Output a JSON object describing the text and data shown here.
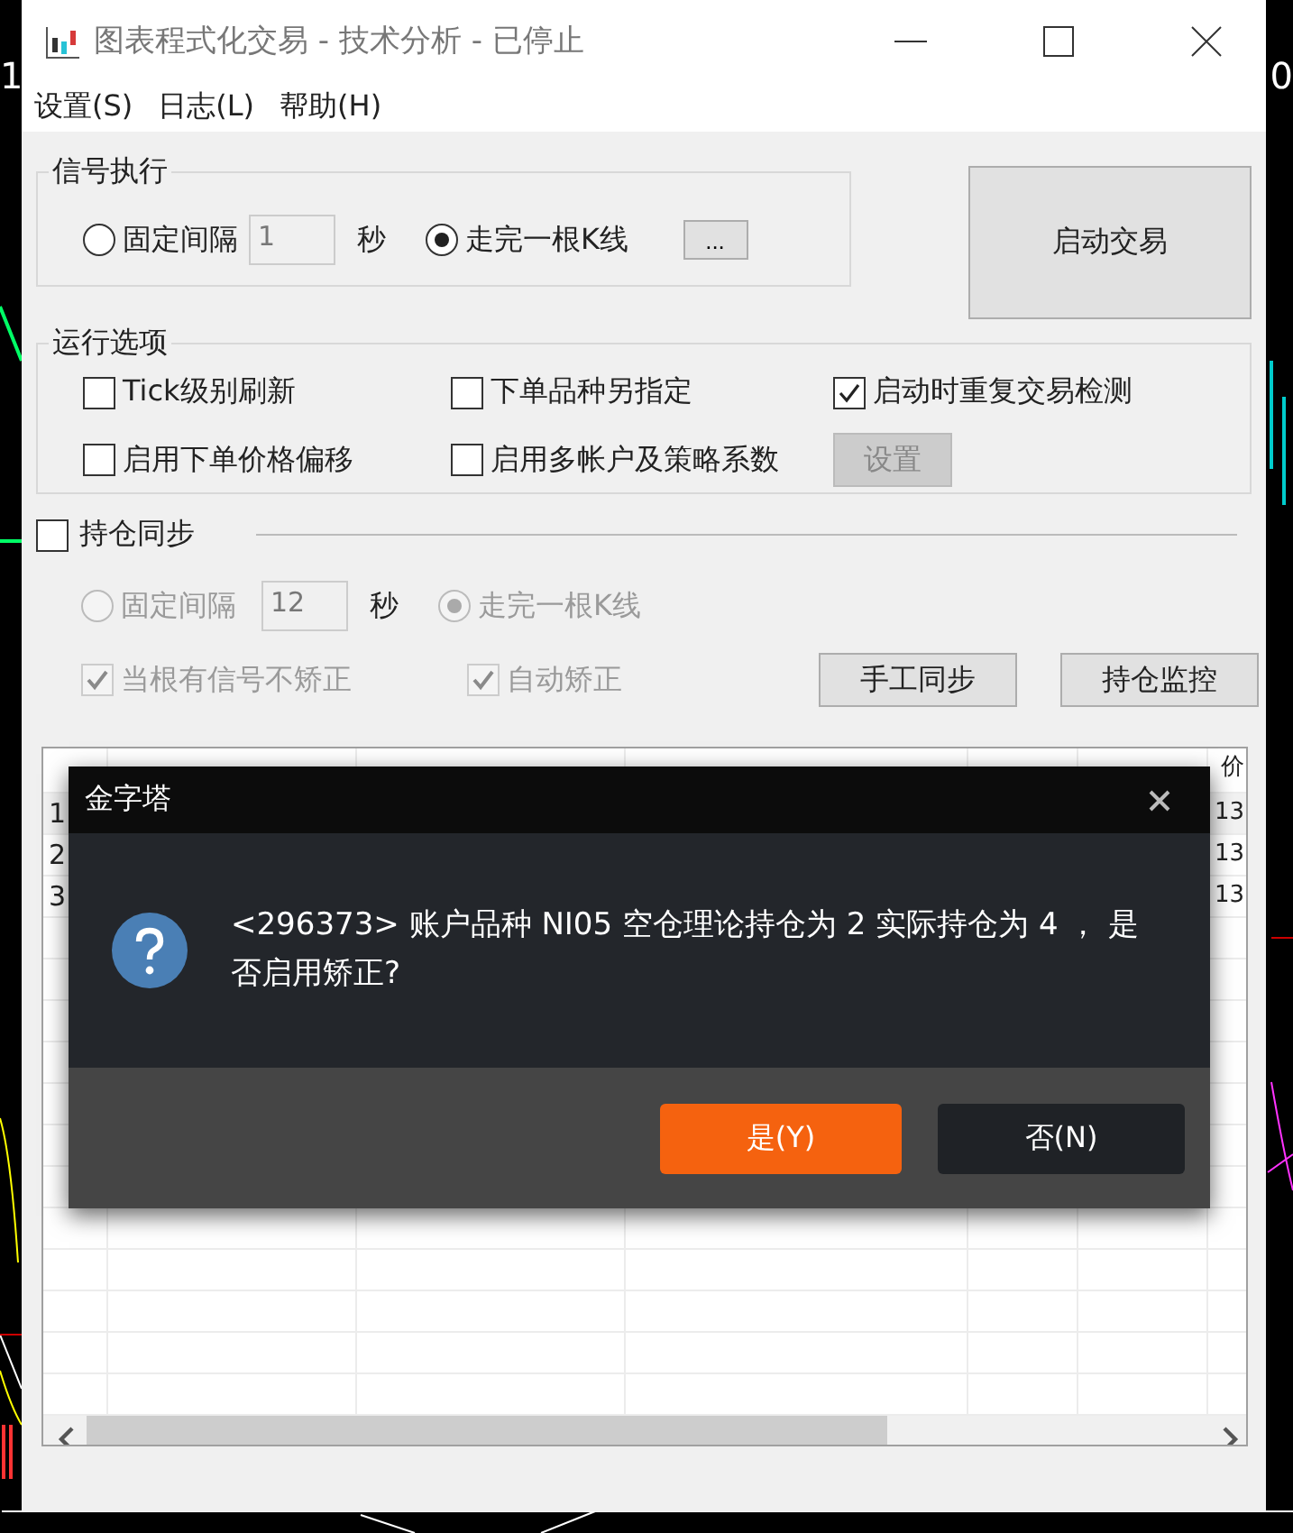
{
  "background_text": [
    "1",
    "0"
  ],
  "window": {
    "title": "图表程式化交易 - 技术分析 - 已停止"
  },
  "menu": [
    "设置(S)",
    "日志(L)",
    "帮助(H)"
  ],
  "signal_execution": {
    "title": "信号执行",
    "interval": {
      "label": "固定间隔",
      "selected": false,
      "value": "1",
      "unit": "秒"
    },
    "bar": {
      "label": "走完一根K线",
      "selected": true
    },
    "more_button": "..."
  },
  "start_button": "启动交易",
  "run_options": {
    "title": "运行选项",
    "items": [
      {
        "kind": "checkbox",
        "label": "Tick级别刷新",
        "checked": false
      },
      {
        "kind": "checkbox",
        "label": "下单品种另指定",
        "checked": false
      },
      {
        "kind": "checkbox",
        "label": "启动时重复交易检测",
        "checked": true
      },
      {
        "kind": "checkbox",
        "label": "启用下单价格偏移",
        "checked": false
      },
      {
        "kind": "checkbox",
        "label": "启用多帐户及策略系数",
        "checked": false
      },
      {
        "kind": "button",
        "label": "设置",
        "disabled": true
      }
    ]
  },
  "position_sync": {
    "label": "持仓同步",
    "checked": false,
    "interval": {
      "label": "固定间隔",
      "selected": false,
      "disabled": true,
      "value": "12",
      "unit": "秒"
    },
    "bar": {
      "label": "走完一根K线",
      "selected": true,
      "disabled": true
    },
    "checkboxes": [
      {
        "label": "当根有信号不矫正",
        "checked": true,
        "disabled": true
      },
      {
        "label": "自动矫正",
        "checked": true,
        "disabled": true
      }
    ],
    "buttons": [
      "手工同步",
      "持仓监控"
    ]
  },
  "table": {
    "last_column_header": "价",
    "rows": [
      {
        "row_number": "1",
        "last_cell": "13"
      },
      {
        "row_number": "2",
        "last_cell": "13"
      },
      {
        "row_number": "3",
        "last_cell": "13"
      }
    ]
  },
  "dialog": {
    "title": "金字塔",
    "message": "<296373> 账户品种 NI05 空仓理论持仓为 2 实际持仓为 4 ， 是否启用矫正?",
    "buttons": [
      {
        "kind": "primary",
        "label": "是(Y)"
      },
      {
        "kind": "secondary",
        "label": "否(N)"
      }
    ]
  }
}
